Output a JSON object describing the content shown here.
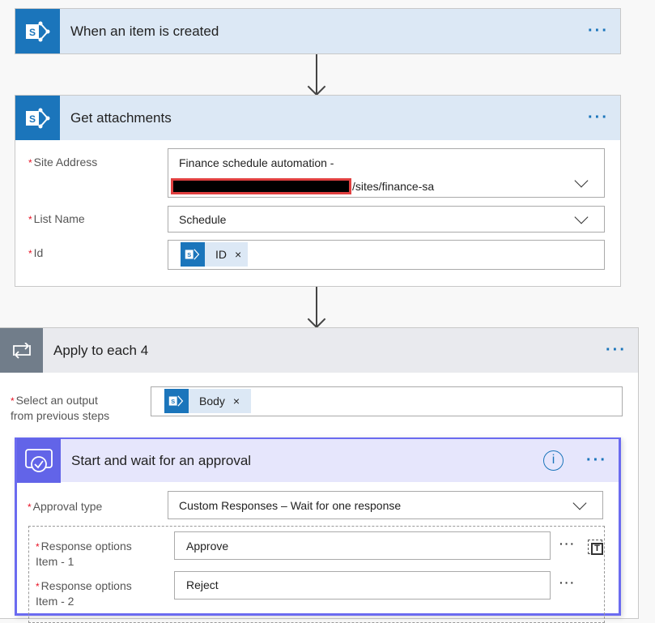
{
  "trigger": {
    "title": "When an item is created",
    "icon": "sharepoint-icon"
  },
  "get_attachments": {
    "title": "Get attachments",
    "icon": "sharepoint-icon",
    "site_address": {
      "label": "Site Address",
      "line1": "Finance schedule automation -",
      "line2": "/sites/finance-sa"
    },
    "list_name": {
      "label": "List Name",
      "value": "Schedule"
    },
    "id": {
      "label": "Id",
      "token": "ID"
    }
  },
  "apply_each": {
    "title": "Apply to each 4",
    "icon": "loop-icon",
    "select_output": {
      "label_line1": "Select an output",
      "label_line2": "from previous steps",
      "token": "Body"
    }
  },
  "approval": {
    "title": "Start and wait for an approval",
    "icon": "approval-icon",
    "approval_type": {
      "label": "Approval type",
      "value": "Custom Responses – Wait for one response"
    },
    "responses": [
      {
        "label_line1": "Response options",
        "label_line2": "Item - 1",
        "value": "Approve"
      },
      {
        "label_line1": "Response options",
        "label_line2": "Item - 2",
        "value": "Reject"
      }
    ]
  },
  "common": {
    "required": "*",
    "more": "···",
    "remove": "×",
    "info": "i"
  },
  "colors": {
    "sharepoint": "#1b75bb",
    "approval": "#6264e8",
    "loop": "#717d8a",
    "required": "#e81123"
  }
}
